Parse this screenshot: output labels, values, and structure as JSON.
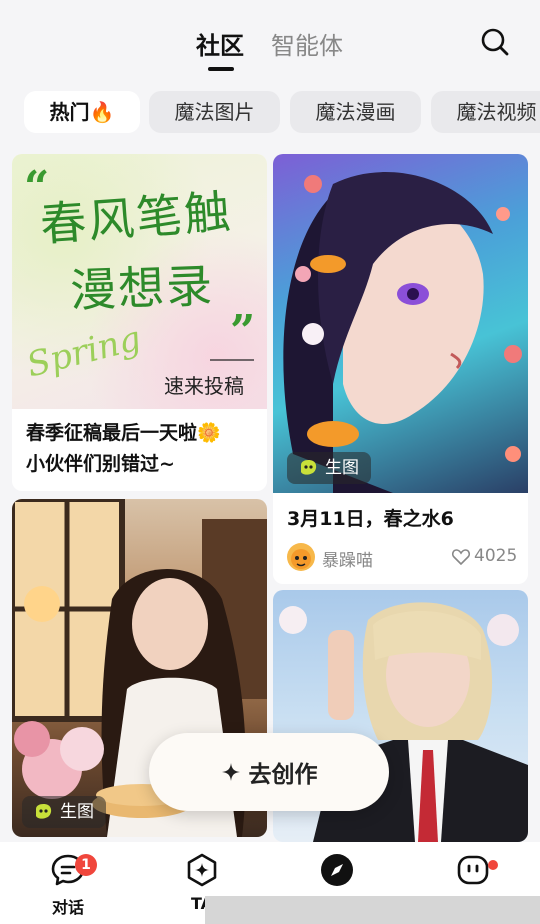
{
  "header": {
    "tabs": [
      {
        "label": "社区",
        "active": true
      },
      {
        "label": "智能体",
        "active": false
      }
    ]
  },
  "pills": [
    {
      "label": "热门🔥",
      "active": true
    },
    {
      "label": "魔法图片",
      "active": false
    },
    {
      "label": "魔法漫画",
      "active": false
    },
    {
      "label": "魔法视频",
      "active": false
    }
  ],
  "cards": {
    "spring_banner": {
      "image_headline_1": "春风笔触",
      "image_headline_2": "漫想录",
      "image_script": "Spring",
      "image_cta": "速来投稿",
      "title_line1": "春季征稿最后一天啦🌼",
      "title_line2": "小伙伴们别错过~"
    },
    "anime_girl": {
      "badge": "生图",
      "title": "3月11日，春之水6",
      "author": "暴躁喵",
      "likes": "4025"
    },
    "cafe_girl": {
      "badge": "生图"
    },
    "blonde_girl": {}
  },
  "create_button": {
    "label": "去创作",
    "icon": "sparkle-icon"
  },
  "bottom_nav": [
    {
      "label": "对话",
      "icon": "chat-icon",
      "badge": "1"
    },
    {
      "label": "TA",
      "icon": "hexagon-sparkle-icon"
    },
    {
      "label": "",
      "icon": "compass-icon"
    },
    {
      "label": "",
      "icon": "robot-face-icon",
      "dot": true
    }
  ],
  "colors": {
    "accent_red": "#f0463c",
    "bg": "#f5f5f7"
  }
}
